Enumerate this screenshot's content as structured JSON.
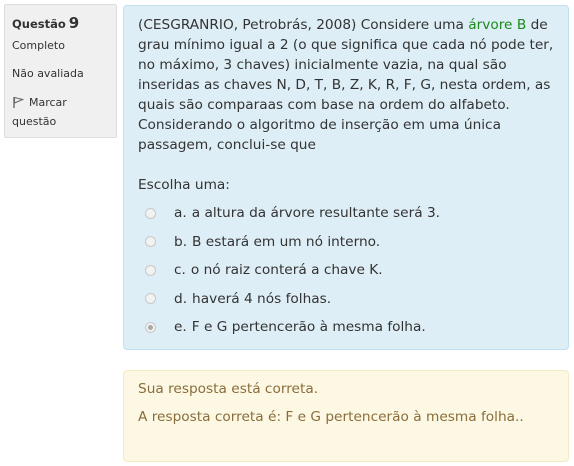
{
  "info": {
    "question_label": "Questão",
    "question_number": "9",
    "state": "Completo",
    "grade": "Não avaliada",
    "flag_label": "Marcar questão",
    "flag_icon": "flag-icon"
  },
  "question": {
    "text_before": "(CESGRANRIO, Petrobrás, 2008) Considere uma ",
    "term": "árvore B",
    "text_after": " de grau mínimo igual a 2 (o que significa que cada nó pode ter, no máximo, 3 chaves) inicialmente vazia, na qual são inseridas as chaves N, D, T, B, Z, K, R, F, G, nesta ordem, as quais são comparaas com base na ordem do alfabeto. Considerando o algoritmo de inserção em uma única passagem, conclui-se que",
    "prompt": "Escolha uma:",
    "answers": [
      {
        "num": "a.",
        "text": "a altura da árvore resultante será 3.",
        "checked": false
      },
      {
        "num": "b.",
        "text": "B estará em um nó interno.",
        "checked": false
      },
      {
        "num": "c.",
        "text": "o nó raiz conterá a chave K.",
        "checked": false
      },
      {
        "num": "d.",
        "text": "haverá 4 nós folhas.",
        "checked": false
      },
      {
        "num": "e.",
        "text": "F e G pertencerão à mesma folha.",
        "checked": true
      }
    ]
  },
  "outcome": {
    "feedback": "Sua resposta está correta.",
    "right_answer": "A resposta correta é: F e G pertencerão à mesma folha.."
  },
  "colors": {
    "formulation_bg": "#deeef6",
    "outcome_bg": "#fcf8e3",
    "outcome_text": "#8a6d3b",
    "term_highlight": "#1a8a1a"
  }
}
